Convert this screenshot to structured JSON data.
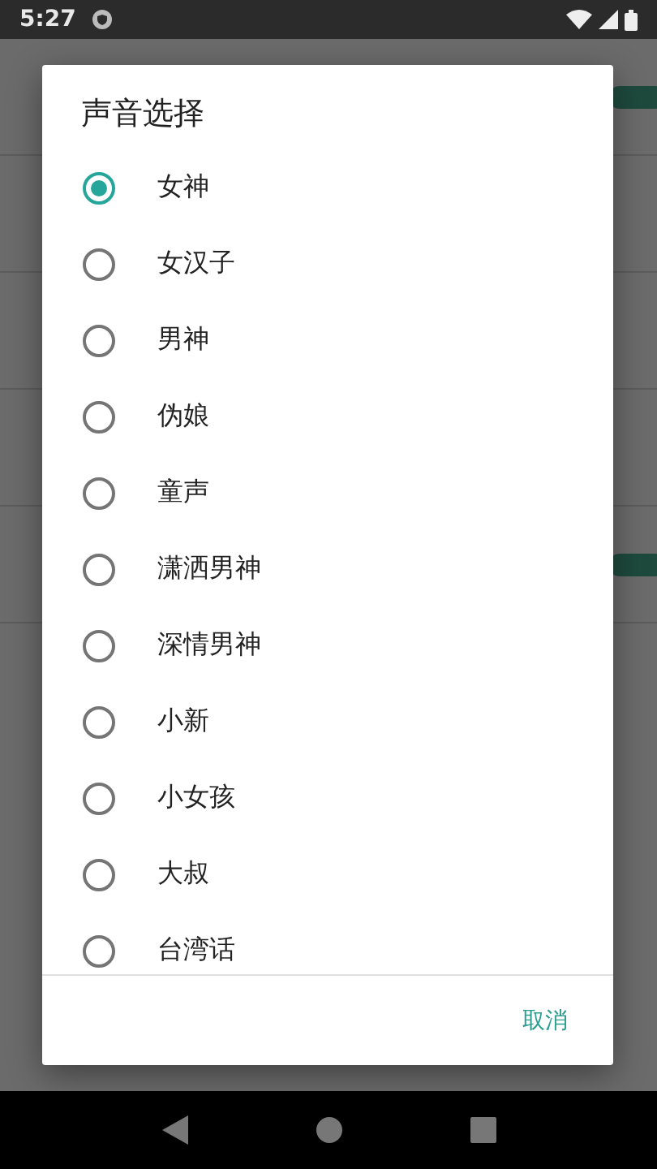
{
  "status_bar": {
    "time": "5:27"
  },
  "settings": [
    {
      "kind": "switch",
      "on": true
    },
    {
      "kind": "plain"
    },
    {
      "kind": "plain"
    },
    {
      "kind": "plain"
    },
    {
      "kind": "switch",
      "on": true
    }
  ],
  "dialog": {
    "title": "声音选择",
    "options": [
      {
        "label": "女神",
        "selected": true
      },
      {
        "label": "女汉子",
        "selected": false
      },
      {
        "label": "男神",
        "selected": false
      },
      {
        "label": "伪娘",
        "selected": false
      },
      {
        "label": "童声",
        "selected": false
      },
      {
        "label": "潇洒男神",
        "selected": false
      },
      {
        "label": "深情男神",
        "selected": false
      },
      {
        "label": "小新",
        "selected": false
      },
      {
        "label": "小女孩",
        "selected": false
      },
      {
        "label": "大叔",
        "selected": false
      },
      {
        "label": "台湾话",
        "selected": false
      }
    ],
    "buttons": [
      "取消"
    ]
  }
}
